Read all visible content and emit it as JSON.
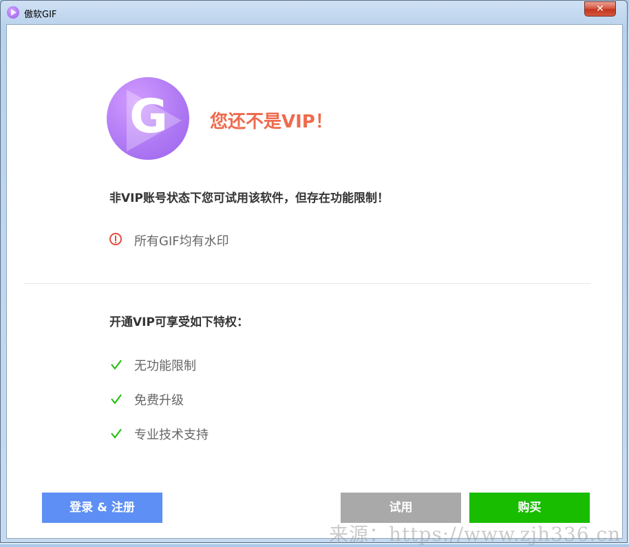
{
  "window": {
    "title": "傲软GIF",
    "close_label": "✕"
  },
  "hero": {
    "logo_letter": "G",
    "headline": "您还不是VIP！"
  },
  "notice": {
    "description": "非VIP账号状态下您可试用该软件，但存在功能限制！",
    "limitation": "所有GIF均有水印"
  },
  "benefits": {
    "title": "开通VIP可享受如下特权：",
    "items": [
      "无功能限制",
      "免费升级",
      "专业技术支持"
    ]
  },
  "buttons": {
    "login": "登录 & 注册",
    "trial": "试用",
    "buy": "购买"
  },
  "watermark": "来源：https://www.zjh336.cn",
  "colors": {
    "headline": "#ef6a4d",
    "login": "#5d8ff4",
    "trial": "#a9a9a9",
    "buy": "#19bd00",
    "check": "#19bd00",
    "warning": "#e04a3c"
  }
}
